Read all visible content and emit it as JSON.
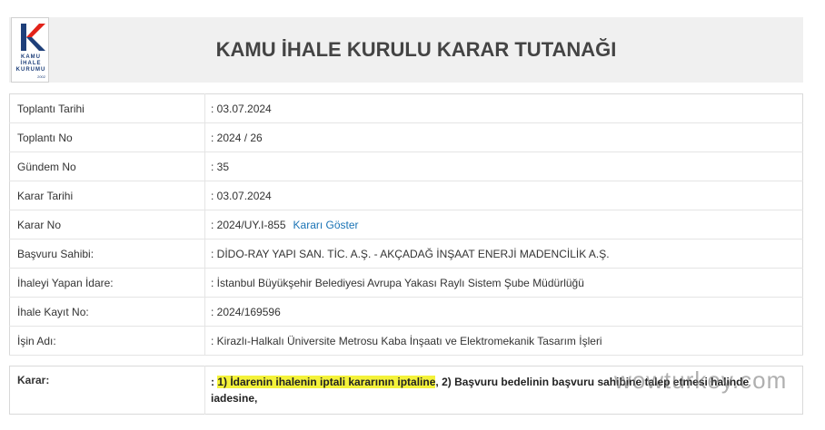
{
  "header": {
    "logo_text_lines": [
      "KAMU",
      "İHALE",
      "KURUMU"
    ],
    "logo_year": "2002",
    "title": "KAMU İHALE KURULU KARAR TUTANAĞI"
  },
  "colors": {
    "logo_blue": "#1e3f7a",
    "logo_red": "#e2231a",
    "link": "#1a73b5",
    "highlight": "#f4f23a"
  },
  "rows": [
    {
      "label": "Toplantı Tarihi",
      "value": ": 03.07.2024"
    },
    {
      "label": "Toplantı No",
      "value": ": 2024 / 26"
    },
    {
      "label": "Gündem No",
      "value": ": 35"
    },
    {
      "label": "Karar Tarihi",
      "value": ": 03.07.2024"
    },
    {
      "label": "Karar No",
      "value": ": 2024/UY.I-855",
      "link": "Kararı Göster"
    },
    {
      "label": "Başvuru Sahibi:",
      "value": ": DİDO-RAY YAPI SAN. TİC. A.Ş. - AKÇADAĞ İNŞAAT ENERJİ MADENCİLİK A.Ş."
    },
    {
      "label": "İhaleyi Yapan İdare:",
      "value": ": İstanbul Büyükşehir Belediyesi Avrupa Yakası Raylı Sistem Şube Müdürlüğü"
    },
    {
      "label": "İhale Kayıt No:",
      "value": ": 2024/169596"
    },
    {
      "label": "İşin Adı:",
      "value": ": Kirazlı-Halkalı Üniversite Metrosu Kaba İnşaatı ve Elektromekanik Tasarım İşleri"
    }
  ],
  "karar": {
    "label": "Karar:",
    "prefix": ": ",
    "highlighted": "1) İdarenin ihalenin iptali kararının iptaline",
    "rest_line1": ", 2) Başvuru bedelinin başvuru sahibine talep etmesi halinde",
    "rest_line2": "iadesine,"
  },
  "watermark": "wowturkey.com"
}
